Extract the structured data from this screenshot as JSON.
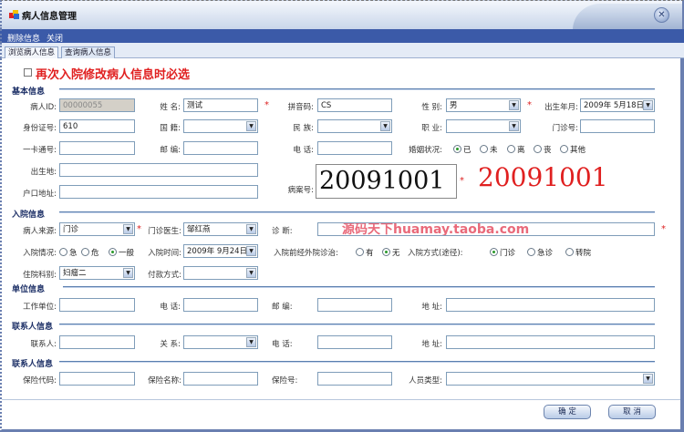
{
  "window": {
    "title": "病人信息管理",
    "close_icon": "close-icon"
  },
  "menu": [
    "删除信息",
    "关闭"
  ],
  "tabs": [
    "浏览病人信息",
    "查询病人信息"
  ],
  "readmit_checkbox": "再次入院修改病人信息时必选",
  "sections": {
    "basic": "基本信息",
    "admission": "入院信息",
    "work": "单位信息",
    "contact": "联系人信息",
    "insurance": "联系人信息"
  },
  "basic": {
    "patient_id": {
      "label": "病人ID:",
      "value": "00000055"
    },
    "name": {
      "label": "姓 名:",
      "value": "测试"
    },
    "pinyin": {
      "label": "拼音码:",
      "value": "CS"
    },
    "gender": {
      "label": "性 别:",
      "value": "男"
    },
    "birth": {
      "label": "出生年月:",
      "value": "2009年 5月18日"
    },
    "id_card": {
      "label": "身份证号:",
      "value": "610"
    },
    "nationality": {
      "label": "国 籍:",
      "value": ""
    },
    "ethnicity": {
      "label": "民 族:",
      "value": ""
    },
    "occupation": {
      "label": "职 业:",
      "value": ""
    },
    "clinic_no": {
      "label": "门诊号:",
      "value": ""
    },
    "card_no": {
      "label": "一卡通号:",
      "value": ""
    },
    "postcode": {
      "label": "邮 编:",
      "value": ""
    },
    "phone": {
      "label": "电 话:",
      "value": ""
    },
    "marital": {
      "label": "婚姻状况:",
      "options": [
        "已",
        "未",
        "离",
        "丧",
        "其他"
      ],
      "selected": "已"
    },
    "birthplace": {
      "label": "出生地:",
      "value": ""
    },
    "household": {
      "label": "户口地址:",
      "value": ""
    },
    "record_no": {
      "label": "病案号:",
      "value": "20091001",
      "display": "20091001"
    }
  },
  "admission": {
    "source": {
      "label": "病人来源:",
      "value": "门诊"
    },
    "doctor": {
      "label": "门诊医生:",
      "value": "邹红燕"
    },
    "diagnosis": {
      "label": "诊 断:",
      "value": "源码天下huamay.taoba.com"
    },
    "condition": {
      "label": "入院情况:",
      "options": [
        "急",
        "危",
        "一般"
      ],
      "selected": "一般"
    },
    "time": {
      "label": "入院时间:",
      "value": "2009年 9月24日"
    },
    "prior_treatment": {
      "label": "入院前经外院诊治:",
      "options": [
        "有",
        "无"
      ],
      "selected": "无"
    },
    "method": {
      "label": "入院方式(途径):",
      "options": [
        "门诊",
        "急诊",
        "转院"
      ],
      "selected": "门诊"
    },
    "department": {
      "label": "住院科别:",
      "value": "妇瘤二"
    },
    "payment": {
      "label": "付款方式:",
      "value": ""
    }
  },
  "work": {
    "unit": "工作单位:",
    "phone": "电 话:",
    "postcode": "邮 编:",
    "address": "地 址:"
  },
  "contact": {
    "person": "联系人:",
    "relation": "关 系:",
    "phone": "电 话:",
    "address": "地 址:"
  },
  "insurance": {
    "code": "保险代码:",
    "name": "保险名称:",
    "number": "保险号:",
    "type": "人员类型:"
  },
  "buttons": {
    "ok": "确 定",
    "cancel": "取 消"
  },
  "colors": {
    "menubar": "#3b5aa8",
    "required": "#dd2222"
  }
}
